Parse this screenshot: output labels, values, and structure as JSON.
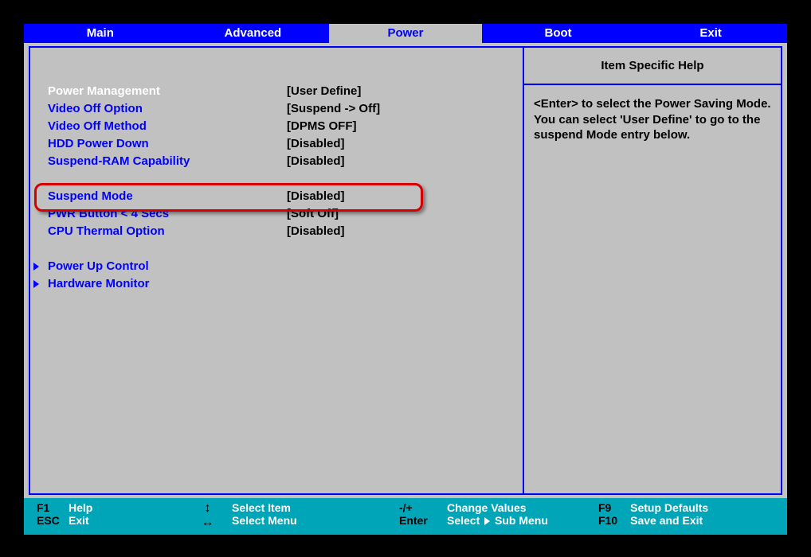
{
  "tabs": [
    "Main",
    "Advanced",
    "Power",
    "Boot",
    "Exit"
  ],
  "active_tab": 2,
  "help": {
    "title": "Item Specific Help",
    "text": "<Enter> to select the Power Saving Mode. You can select 'User Define' to go to the suspend Mode entry below."
  },
  "entries": {
    "power_mgmt": {
      "label": "Power Management",
      "value": "[User Define]"
    },
    "video_off_opt": {
      "label": "Video Off Option",
      "value": "[Suspend -> Off]"
    },
    "video_off_meth": {
      "label": "Video Off Method",
      "value": "[DPMS OFF]"
    },
    "hdd_power": {
      "label": "HDD Power Down",
      "value": "[Disabled]"
    },
    "sus_ram": {
      "label": "Suspend-RAM Capability",
      "value": "[Disabled]"
    },
    "sus_mode": {
      "label": "Suspend Mode",
      "value": "[Disabled]"
    },
    "pwr_btn": {
      "label": "PWR Button < 4 Secs",
      "value": "[Soft Off]"
    },
    "cpu_therm": {
      "label": "CPU Thermal Option",
      "value": "[Disabled]"
    },
    "pwr_up": {
      "label": "Power Up Control"
    },
    "hw_mon": {
      "label": "Hardware Monitor"
    }
  },
  "footer": {
    "f1": "F1",
    "help": "Help",
    "esc": "ESC",
    "exit": "Exit",
    "select_item": "Select Item",
    "select_menu": "Select Menu",
    "pm": "-/+",
    "change": "Change Values",
    "enter": "Enter",
    "select": "Select",
    "sub": "Sub Menu",
    "f9": "F9",
    "defaults": "Setup Defaults",
    "f10": "F10",
    "save": "Save and Exit"
  }
}
